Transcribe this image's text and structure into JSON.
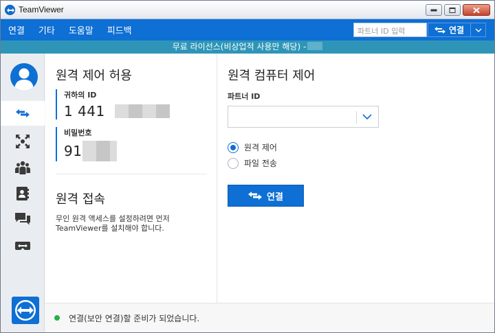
{
  "window": {
    "title": "TeamViewer"
  },
  "menu": {
    "items": [
      "연결",
      "기타",
      "도움말",
      "피드백"
    ],
    "partner_placeholder": "파트너 ID 입력",
    "connect_label": "연결"
  },
  "license": {
    "text": "무료 라이선스(비상업적 사용만 해당) -"
  },
  "remote_control": {
    "heading": "원격 제어 허용",
    "your_id_label": "귀하의 ID",
    "your_id_value": "1 441",
    "password_label": "비밀번호",
    "password_value": "91"
  },
  "remote_access": {
    "heading": "원격 접속",
    "description": "무인 원격 액세스를 설정하려면 먼저 TeamViewer를 설치해야 합니다."
  },
  "control_computer": {
    "heading": "원격 컴퓨터 제어",
    "partner_id_label": "파트너 ID",
    "options": [
      "원격 제어",
      "파일 전송"
    ],
    "selected_option": "원격 제어",
    "connect_label": "연결"
  },
  "status": {
    "text": "연결(보안 연결)할 준비가 되었습니다.",
    "color": "#27b04b"
  },
  "colors": {
    "accent": "#0e6fd4",
    "license_bar": "#2e95b8"
  }
}
